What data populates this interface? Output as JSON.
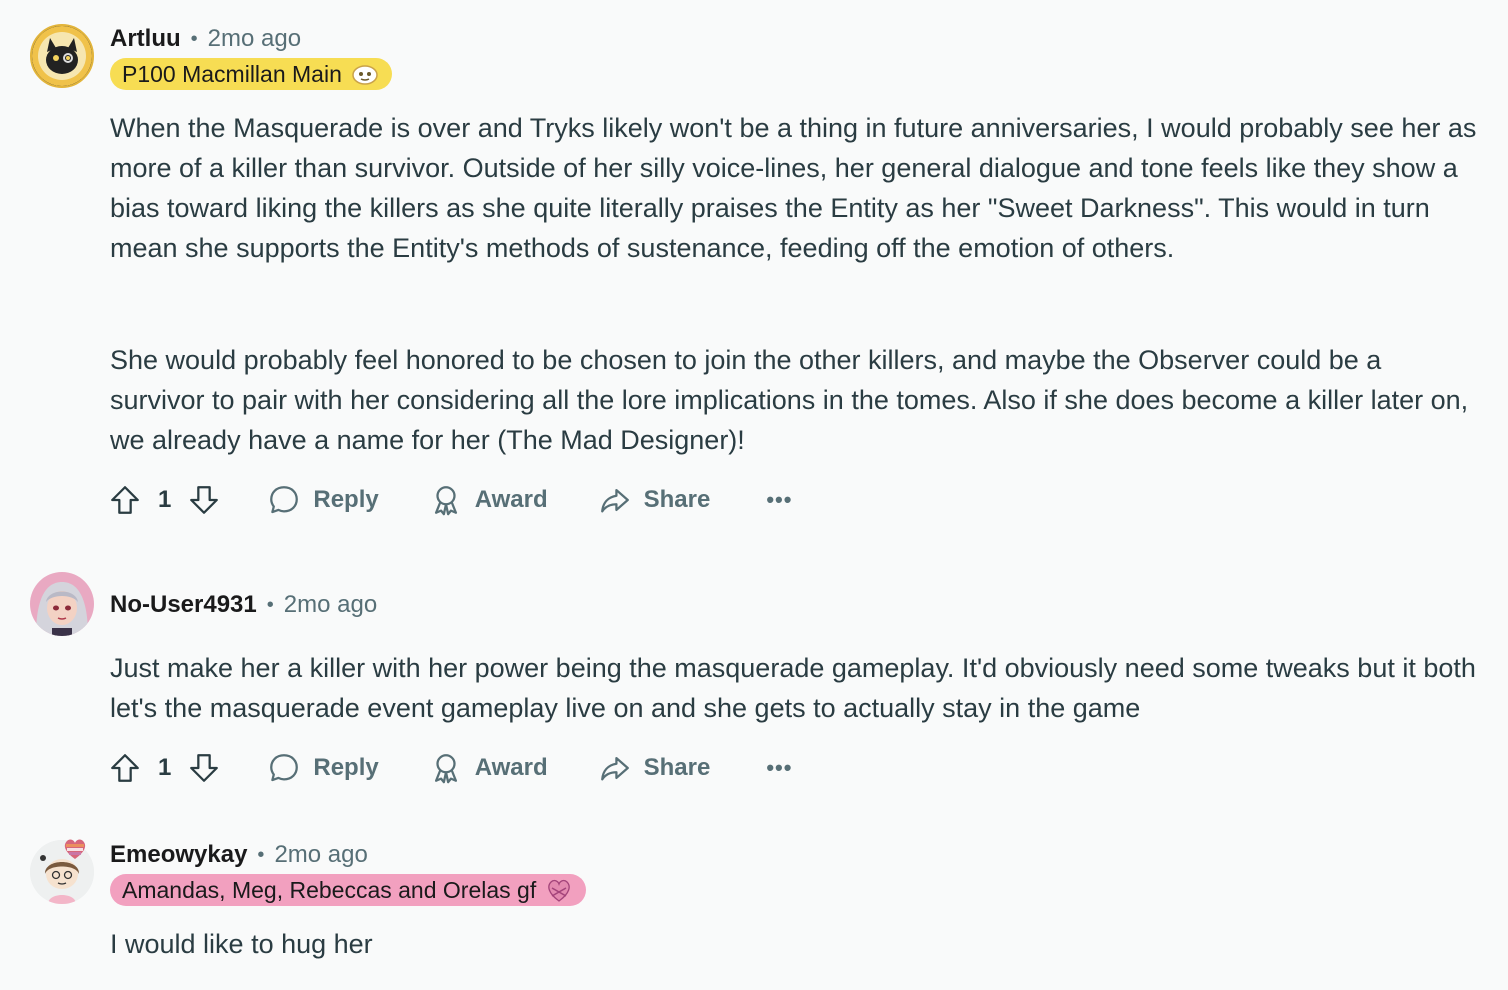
{
  "comments": [
    {
      "username": "Artluu",
      "time": "2mo ago",
      "flair": "P100 Macmillan Main",
      "flair_color": "#f7dd53",
      "paragraphs": [
        "When the Masquerade is over and Tryks likely won't be a thing in future anniversaries, I would probably see her as more of a killer than survivor. Outside of her silly voice-lines, her general dialogue and tone feels like they show a bias toward liking the killers as she quite literally praises the Entity as her \"Sweet Darkness\". This would in turn mean she supports the Entity's methods of sustenance, feeding off the emotion of others.",
        "She would probably feel honored to be chosen to join the other killers, and maybe the Observer could be a survivor to pair with her considering all the lore implications in the tomes. Also if she does become a killer later on, we already have a name for her (The Mad Designer)!"
      ],
      "votes": "1",
      "reply_label": "Reply",
      "award_label": "Award",
      "share_label": "Share",
      "more_label": "•••"
    },
    {
      "username": "No-User4931",
      "time": "2mo ago",
      "paragraphs": [
        "Just make her a killer with her power being the masquerade gameplay. It'd obviously need some tweaks but it both let's the masquerade event gameplay live on and she gets to actually stay in the game"
      ],
      "votes": "1",
      "reply_label": "Reply",
      "award_label": "Award",
      "share_label": "Share",
      "more_label": "•••"
    },
    {
      "username": "Emeowykay",
      "time": "2mo ago",
      "flair": "Amandas, Meg, Rebeccas and Orelas gf",
      "flair_color": "#f2a0bf",
      "paragraphs": [
        "I would like to hug her"
      ]
    }
  ],
  "separator": "•",
  "icons": {
    "upvote": "arrow-up-icon",
    "downvote": "arrow-down-icon",
    "reply": "speech-bubble-icon",
    "award": "ribbon-award-icon",
    "share": "share-arrow-icon"
  }
}
